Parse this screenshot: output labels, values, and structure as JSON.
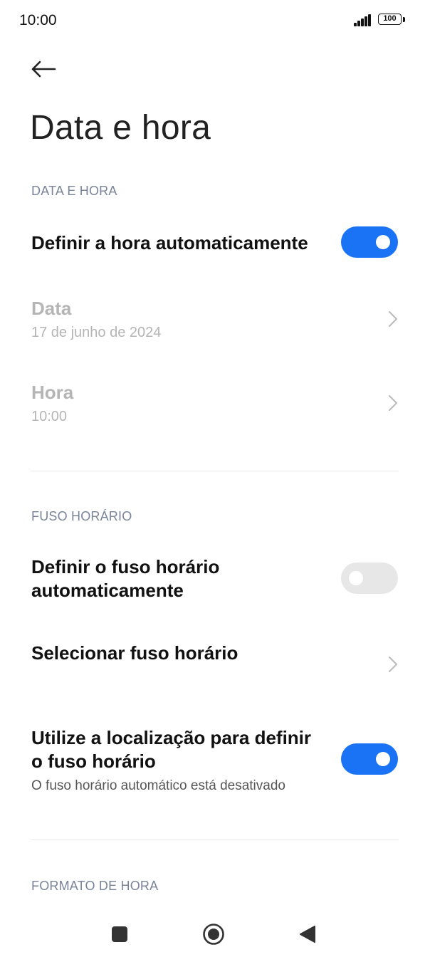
{
  "status_bar": {
    "time": "10:00",
    "battery": "100",
    "signal_icon": "signal-bars-icon",
    "battery_icon": "battery-icon"
  },
  "header": {
    "back_icon": "arrow-left-icon",
    "title": "Data e hora"
  },
  "sections": {
    "date_time": {
      "header": "DATA E HORA",
      "auto_time": {
        "title": "Definir a hora automaticamente",
        "enabled": true
      },
      "date": {
        "title": "Data",
        "value": "17 de junho de 2024"
      },
      "time": {
        "title": "Hora",
        "value": "10:00"
      }
    },
    "timezone": {
      "header": "FUSO HORÁRIO",
      "auto_timezone": {
        "title_line1": "Definir o fuso horário",
        "title_line2": "automaticamente",
        "enabled": false
      },
      "select_timezone": {
        "title": "Selecionar fuso horário"
      },
      "use_location": {
        "title_line1": "Utilize a localização para definir",
        "title_line2": "o fuso horário",
        "subtitle": "O fuso horário automático está desativado",
        "enabled": true
      }
    },
    "time_format": {
      "header": "FORMATO DE HORA"
    }
  },
  "nav_bar": {
    "recents_icon": "square-icon",
    "home_icon": "circle-icon",
    "back_icon": "triangle-back-icon"
  },
  "colors": {
    "accent": "#1a73f5",
    "toggle_off": "#e7e7e7",
    "section_header": "#7a8499",
    "disabled_text": "#b5b5b5"
  }
}
